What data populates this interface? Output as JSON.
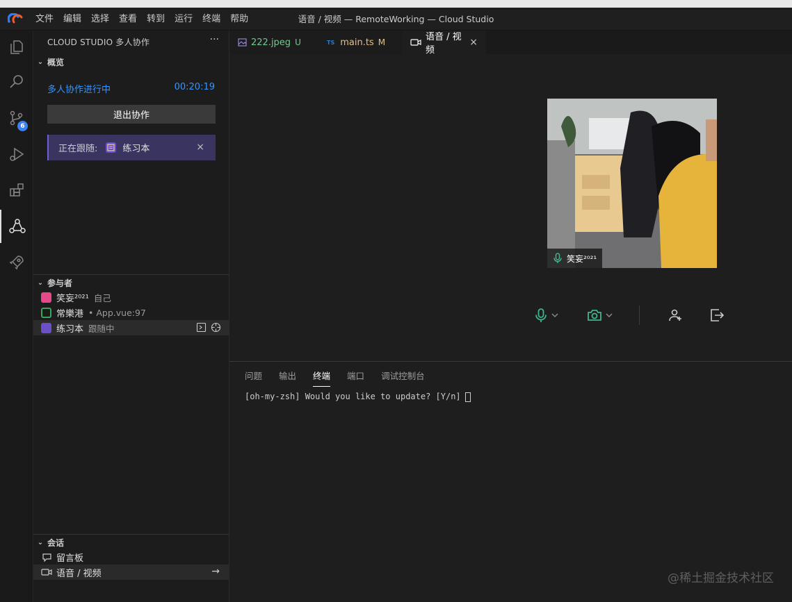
{
  "window": {
    "title": "语音 / 视频 — RemoteWorking — Cloud Studio"
  },
  "menu": [
    "文件",
    "编辑",
    "选择",
    "查看",
    "转到",
    "运行",
    "终端",
    "帮助"
  ],
  "activity_bar": {
    "items": [
      "files-icon",
      "search-icon",
      "source-control-icon",
      "run-debug-icon",
      "extensions-icon",
      "collaboration-icon",
      "rocket-icon"
    ],
    "source_control_badge": "6"
  },
  "sidebar": {
    "header": "CLOUD STUDIO 多人协作",
    "more": "···",
    "overview": {
      "title": "概览",
      "status": "多人协作进行中",
      "elapsed": "00:20:19",
      "exit_button": "退出协作",
      "following_label": "正在跟随:",
      "following_name": "练习本",
      "close": "×"
    },
    "participants": {
      "title": "参与者",
      "items": [
        {
          "name": "笑妄²⁰²¹",
          "detail": "自己",
          "color": "#e34a8a"
        },
        {
          "name": "常樂港",
          "detail": "• App.vue:97",
          "color": "#3aa55d"
        },
        {
          "name": "练习本",
          "detail": "跟随中",
          "color": "#6a4fc9"
        }
      ]
    },
    "conversation": {
      "title": "会话",
      "items": [
        {
          "label": "留言板",
          "icon": "comment-icon"
        },
        {
          "label": "语音 / 视频",
          "icon": "video-icon"
        }
      ],
      "arrow": "→"
    }
  },
  "tabs": [
    {
      "label": "222.jpeg",
      "status": "U",
      "icon": "image-icon",
      "color": "#73c991"
    },
    {
      "label": "main.ts",
      "status": "M",
      "icon": "ts-icon",
      "color": "#e2c08d"
    },
    {
      "label": "语音 / 视频",
      "status": "",
      "icon": "video-icon",
      "color": "#ffffff"
    }
  ],
  "ts_badge": "TS",
  "video": {
    "participant": "笑妄²⁰²¹"
  },
  "panel": {
    "tabs": [
      "问题",
      "输出",
      "终端",
      "端口",
      "调试控制台"
    ],
    "active_tab": "终端",
    "terminal_line": "[oh-my-zsh] Would you like to update? [Y/n]"
  },
  "watermark": "@稀土掘金技术社区",
  "colors": {
    "accent_blue": "#3794ff",
    "mic_green": "#3fb68b",
    "follow_bg": "#3a3560"
  }
}
